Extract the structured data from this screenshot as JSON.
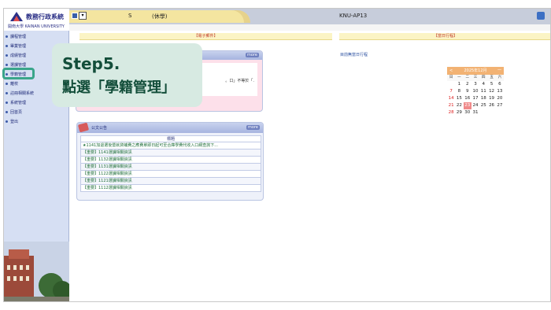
{
  "app": {
    "title": "教務行政系統",
    "subtitle": "開南大學 KAINAN UNIVERSITY"
  },
  "topbar": {
    "user": "S",
    "status": "(休學)",
    "system": "KNU-AP13",
    "select_value": "▾"
  },
  "sidebar": {
    "items": [
      {
        "label": "課程管理"
      },
      {
        "label": "畢業管理"
      },
      {
        "label": "成績管理"
      },
      {
        "label": "選課管理"
      },
      {
        "label": "學籍管理"
      },
      {
        "label": "離校"
      },
      {
        "label": "註冊相關系統"
      },
      {
        "label": "系統管理"
      },
      {
        "label": "回首頁"
      },
      {
        "label": "登出"
      }
    ]
  },
  "columns": {
    "mail": "【電子郵件】",
    "calendar": "【當日行程】"
  },
  "mail_panel": {
    "more": "more",
    "row_text": "。口」不等於「."
  },
  "news_panel": {
    "title": "公文公告",
    "more": "more",
    "column": "標題",
    "rows": [
      "★1141加退選後暨就貸補費之應費單即日起可至合庫學費代收入口網查詢下...",
      "【重要】1141選課相關資訊",
      "【重要】1132選課相關資訊",
      "【重要】1131選課相關資訊",
      "【重要】1122選課相關資訊",
      "【重要】1121選課相關資訊",
      "【重要】1112選課相關資訊"
    ]
  },
  "calendar": {
    "today_link": "目前無當日行程",
    "month": "2025年12月",
    "prev": "<",
    "next": "一",
    "weekdays": [
      "日",
      "一",
      "二",
      "三",
      "四",
      "五",
      "六"
    ],
    "days": [
      "",
      "1",
      "2",
      "3",
      "4",
      "5",
      "6",
      "7",
      "8",
      "9",
      "10",
      "11",
      "12",
      "13",
      "14",
      "15",
      "16",
      "17",
      "18",
      "19",
      "20",
      "21",
      "22",
      "23",
      "24",
      "25",
      "26",
      "27",
      "28",
      "29",
      "30",
      "31",
      "",
      "",
      ""
    ],
    "today": "23"
  },
  "callout": {
    "line1": "Step5.",
    "line2": "點選「學籍管理」"
  },
  "colors": {
    "accent": "#3aa58a",
    "sidebar": "#d6dff3",
    "header_text": "#c0392b"
  }
}
